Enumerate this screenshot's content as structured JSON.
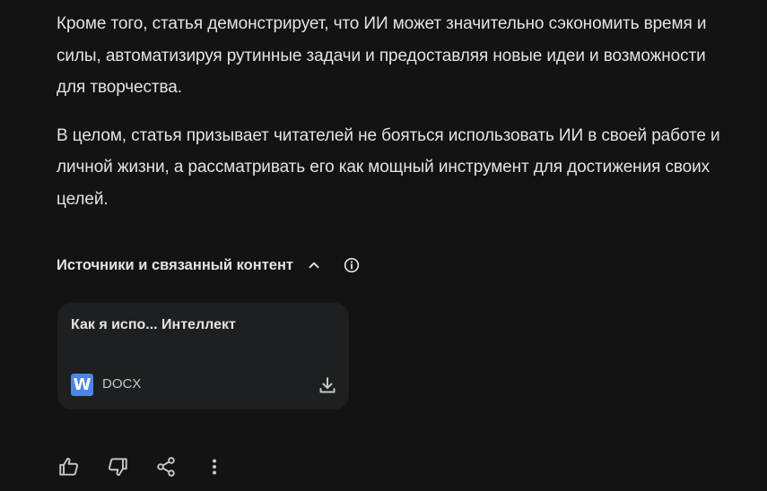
{
  "content": {
    "paragraphs": [
      "Кроме того, статья демонстрирует, что ИИ может значительно сэкономить время и силы, автоматизируя рутинные задачи и предоставляя новые идеи и возможности для творчества.",
      "В целом, статья призывает читателей не бояться использовать ИИ в своей работе и личной жизни, а рассматривать его как мощный инструмент для достижения своих целей."
    ]
  },
  "sources": {
    "title": "Источники и связанный контент",
    "toggle_icon": "chevron-up-icon",
    "info_icon": "info-icon",
    "card": {
      "title": "Как я испо... Интеллект",
      "file_badge": "W",
      "file_type": "DOCX",
      "download_icon": "download-icon"
    }
  },
  "actions": {
    "icons": [
      "thumbs-up-icon",
      "thumbs-down-icon",
      "share-icon",
      "more-vert-icon"
    ]
  },
  "colors": {
    "background": "#131314",
    "text": "#e3e3e3",
    "card": "#1e1f20",
    "word_badge": "#4a86e8"
  }
}
